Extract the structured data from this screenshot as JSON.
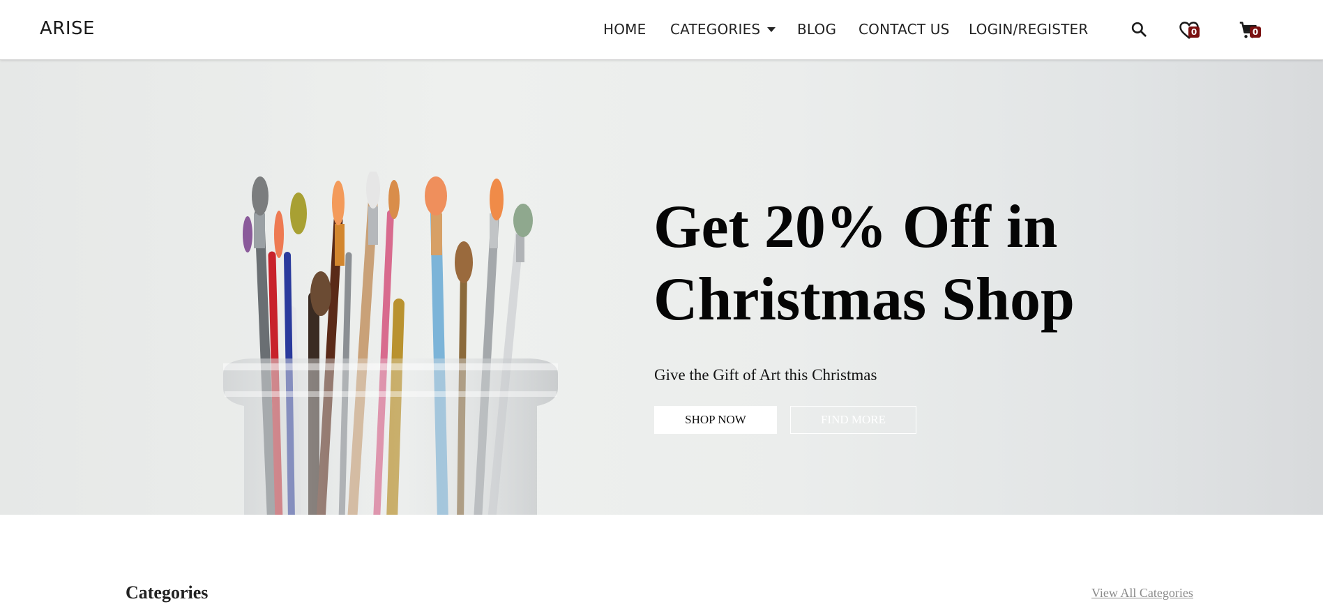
{
  "brand": "ARISE",
  "nav": {
    "home": "HOME",
    "categories": "CATEGORIES",
    "blog": "BLOG",
    "contact": "CONTACT US",
    "login": "LOGIN/REGISTER"
  },
  "icons": {
    "search": "search-icon",
    "wishlist": "heart-icon",
    "cart": "cart-icon"
  },
  "wishlist_count": "0",
  "cart_count": "0",
  "hero": {
    "title_line1": "Get 20% Off in",
    "title_line2": "Christmas Shop",
    "subtitle": "Give the Gift of Art this Christmas",
    "shop_now": "SHOP NOW",
    "find_more": "FIND MORE"
  },
  "categories_section": {
    "title": "Categories",
    "view_all": "View All Categories"
  },
  "colors": {
    "badge": "#7a1010",
    "hero_bg": "#eceeed"
  }
}
